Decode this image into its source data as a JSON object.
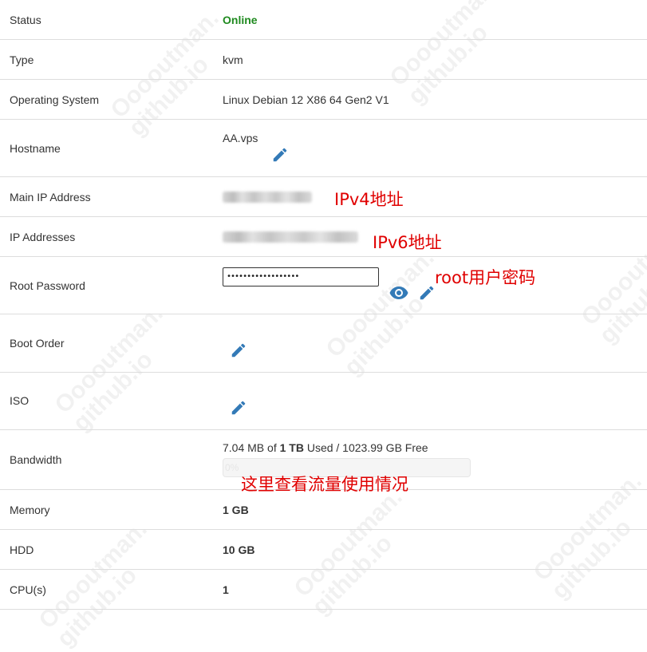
{
  "rows": {
    "status": {
      "label": "Status",
      "value": "Online"
    },
    "type": {
      "label": "Type",
      "value": "kvm"
    },
    "os": {
      "label": "Operating System",
      "value": "Linux Debian 12 X86 64 Gen2 V1"
    },
    "hostname": {
      "label": "Hostname",
      "value": "AA.vps"
    },
    "main_ip": {
      "label": "Main IP Address",
      "annotation": "IPv4地址"
    },
    "ip_addresses": {
      "label": "IP Addresses",
      "annotation": "IPv6地址"
    },
    "root_password": {
      "label": "Root Password",
      "value": "••••••••••••••••••",
      "annotation": "root用户密码"
    },
    "boot_order": {
      "label": "Boot Order"
    },
    "iso": {
      "label": "ISO"
    },
    "bandwidth": {
      "label": "Bandwidth",
      "used": "7.04 MB of ",
      "total": "1 TB",
      "rest": " Used / 1023.99 GB Free",
      "progress_text": "0%",
      "progress_fraction": 0,
      "annotation": "这里查看流量使用情况"
    },
    "memory": {
      "label": "Memory",
      "value": "1 GB"
    },
    "hdd": {
      "label": "HDD",
      "value": "10 GB"
    },
    "cpu": {
      "label": "CPU(s)",
      "value": "1"
    }
  },
  "watermark_text": "Ooooutman.\ngithub.io",
  "icons": {
    "edit": "pencil-icon",
    "reveal": "eye-icon"
  },
  "colors": {
    "online": "#1f8a1f",
    "icon": "#337ab7",
    "annotation": "#e00000",
    "border": "#dddddd"
  }
}
